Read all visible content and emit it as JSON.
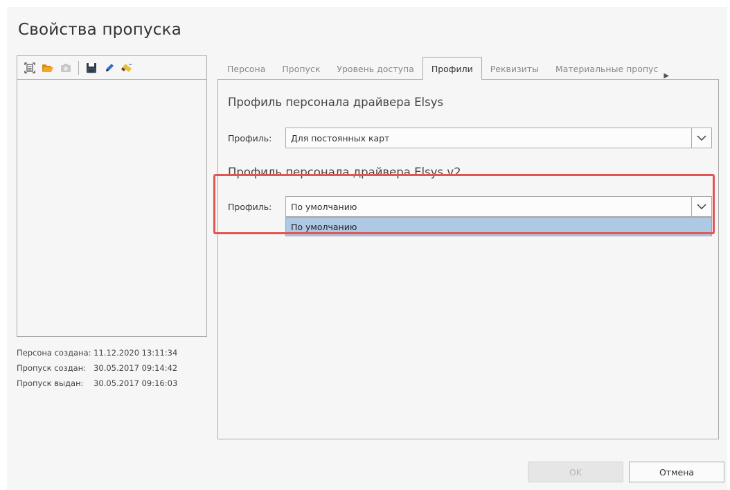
{
  "window": {
    "title": "Свойства пропуска"
  },
  "toolbar": {
    "icons": [
      "scan-icon",
      "folder-open-icon",
      "camera-icon",
      "save-icon",
      "edit-icon",
      "erase-icon"
    ]
  },
  "info": {
    "person_created_label": "Персона создана:",
    "person_created_value": "11.12.2020 13:11:34",
    "pass_created_label": "Пропуск создан:",
    "pass_created_value": "30.05.2017 09:14:42",
    "pass_issued_label": "Пропуск выдан:",
    "pass_issued_value": "30.05.2017 09:16:03"
  },
  "tabs": [
    {
      "label": "Персона"
    },
    {
      "label": "Пропуск"
    },
    {
      "label": "Уровень доступа"
    },
    {
      "label": "Профили",
      "active": true
    },
    {
      "label": "Реквизиты"
    },
    {
      "label": "Материальные пропус"
    }
  ],
  "sections": {
    "elsys": {
      "title": "Профиль персонала драйвера Elsys",
      "field_label": "Профиль:",
      "value": "Для постоянных карт"
    },
    "elsys_v2": {
      "title": "Профиль персонала драйвера Elsys v2",
      "field_label": "Профиль:",
      "value": "По умолчанию",
      "options": [
        "По умолчанию"
      ]
    }
  },
  "buttons": {
    "ok": "OK",
    "cancel": "Отмена"
  },
  "colors": {
    "highlight": "#e05656",
    "dropdown_selected": "#adc9e3",
    "folder": "#f5a623",
    "pen": "#2a6fd6"
  }
}
